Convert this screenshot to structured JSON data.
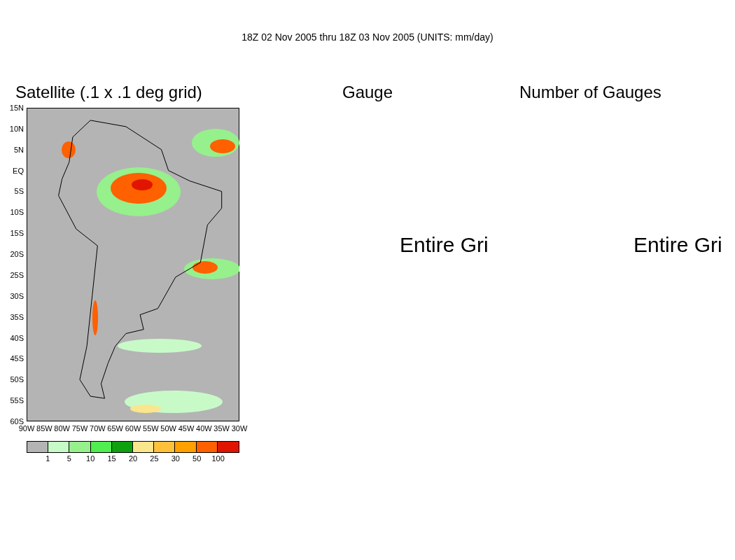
{
  "title": "18Z 02 Nov 2005 thru 18Z 03 Nov 2005 (UNITS: mm/day)",
  "panels": [
    {
      "kind": "map",
      "title": "Satellite (.1 x .1 deg grid)"
    },
    {
      "kind": "message",
      "title": "Gauge",
      "message": "Entire Gri"
    },
    {
      "kind": "message",
      "title": "Number of Gauges",
      "message": "Entire Gri"
    }
  ],
  "map": {
    "y_ticks": [
      "15N",
      "10N",
      "5N",
      "EQ",
      "5S",
      "10S",
      "15S",
      "20S",
      "25S",
      "30S",
      "35S",
      "40S",
      "45S",
      "50S",
      "55S",
      "60S"
    ],
    "x_ticks": [
      "90W",
      "85W",
      "80W",
      "75W",
      "70W",
      "65W",
      "60W",
      "55W",
      "50W",
      "45W",
      "40W",
      "35W",
      "30W"
    ]
  },
  "colorbar": {
    "swatches": [
      {
        "color": "#b4b4b4"
      },
      {
        "color": "#c8fac8"
      },
      {
        "color": "#96f08c"
      },
      {
        "color": "#50ee50"
      },
      {
        "color": "#0fa00f"
      },
      {
        "color": "#fae68c"
      },
      {
        "color": "#ffc03c"
      },
      {
        "color": "#ffa000"
      },
      {
        "color": "#ff6000"
      },
      {
        "color": "#e11400"
      }
    ],
    "labels": [
      "1",
      "5",
      "10",
      "15",
      "20",
      "25",
      "30",
      "50",
      "100"
    ]
  }
}
